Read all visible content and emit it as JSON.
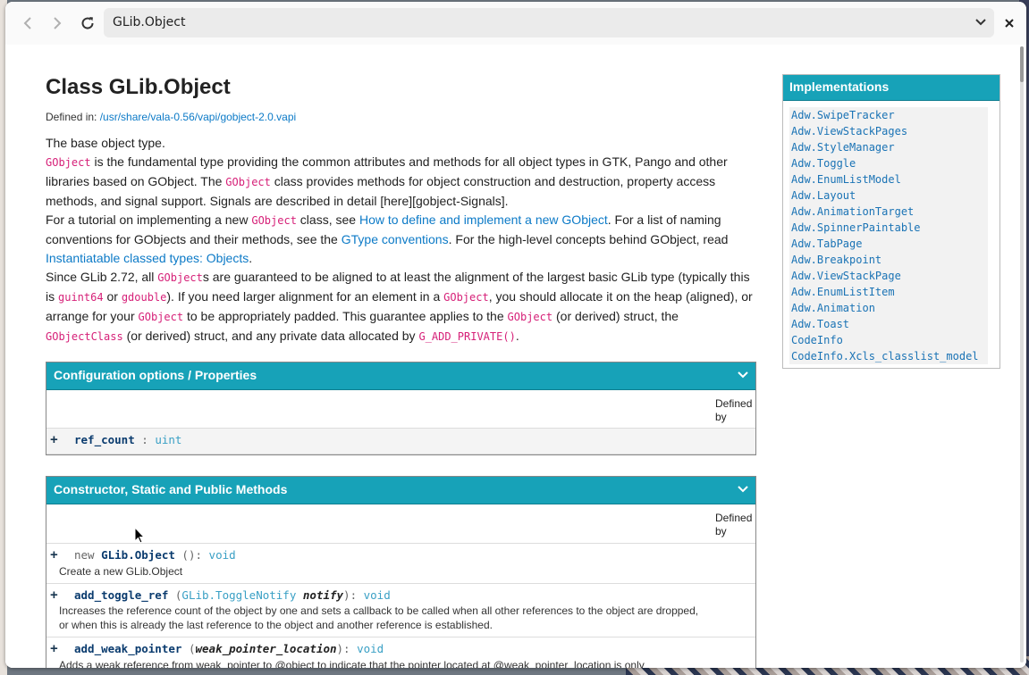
{
  "browser": {
    "page_title": "GLib.Object"
  },
  "page": {
    "heading": "Class GLib.Object",
    "defined_in_label": "Defined in: ",
    "defined_in_path": "/usr/share/vala-0.56/vapi/gobject-2.0.vapi",
    "desc": {
      "p1": "The base object type.",
      "p2_code1": "GObject",
      "p2_t1": " is the fundamental type providing the common attributes and methods for all object types in GTK, Pango and other libraries based on GObject. The ",
      "p2_code2": "GObject",
      "p2_t2": " class provides methods for object construction and destruction, property access methods, and signal support. Signals are described in detail [here][gobject-Signals].",
      "p3_t1": "For a tutorial on implementing a new ",
      "p3_code1": "GObject",
      "p3_t2": " class, see ",
      "p3_link1": "How to define and implement a new GObject",
      "p3_t3": ". For a list of naming conventions for GObjects and their methods, see the ",
      "p3_link2": "GType conventions",
      "p3_t4": ". For the high-level concepts behind GObject, read ",
      "p3_link3": "Instantiatable classed types: Objects",
      "p3_t5": ".",
      "p4_t1": "Since GLib 2.72, all ",
      "p4_code1": "GObject",
      "p4_t2": "s are guaranteed to be aligned to at least the alignment of the largest basic GLib type (typically this is ",
      "p4_code2": "guint64",
      "p4_t3": " or ",
      "p4_code3": "gdouble",
      "p4_t4": "). If you need larger alignment for an element in a ",
      "p4_code4": "GObject",
      "p4_t5": ", you should allocate it on the heap (aligned), or arrange for your ",
      "p4_code5": "GObject",
      "p4_t6": " to be appropriately padded. This guarantee applies to the ",
      "p4_code6": "GObject",
      "p4_t7": " (or derived) struct, the ",
      "p4_code7": "GObjectClass",
      "p4_t8": " (or derived) struct, and any private data allocated by ",
      "p4_code8": "G_ADD_PRIVATE()",
      "p4_t9": "."
    },
    "props_panel": {
      "title": "Configuration options / Properties",
      "defined_by": "Defined by",
      "rows": [
        {
          "plus": "+",
          "name": "ref_count",
          "sep": " : ",
          "type": "uint"
        }
      ]
    },
    "methods_panel": {
      "title": "Constructor, Static and Public Methods",
      "defined_by": "Defined by",
      "rows": [
        {
          "plus": "+",
          "prefix": "new ",
          "name": "GLib.Object",
          "args": " ()",
          "sep": ": ",
          "ret": "void",
          "desc": "Create a new GLib.Object"
        },
        {
          "plus": "+",
          "name": "add_toggle_ref",
          "open": " (",
          "arg_type": "GLib.ToggleNotify",
          "arg_name": "notify",
          "close": "): ",
          "ret": "void",
          "desc": "Increases the reference count of the object by one and sets a callback to be called when all other references to the object are dropped, or when this is already the last reference to the object and another reference is established."
        },
        {
          "plus": "+",
          "name": "add_weak_pointer",
          "open": " (",
          "arg_name": "weak_pointer_location",
          "close": "): ",
          "ret": "void",
          "desc": "Adds a weak reference from weak_pointer to @object to indicate that the pointer located at @weak_pointer_location is only"
        }
      ]
    },
    "implementations": {
      "title": "Implementations",
      "items": [
        "Adw.SwipeTracker",
        "Adw.ViewStackPages",
        "Adw.StyleManager",
        "Adw.Toggle",
        "Adw.EnumListModel",
        "Adw.Layout",
        "Adw.AnimationTarget",
        "Adw.SpinnerPaintable",
        "Adw.TabPage",
        "Adw.Breakpoint",
        "Adw.ViewStackPage",
        "Adw.EnumListItem",
        "Adw.Animation",
        "Adw.Toast",
        "CodeInfo",
        "CodeInfo.Xcls_classlist_model"
      ]
    }
  },
  "colors": {
    "accent": "#17a2b8",
    "link": "#0c7ac7",
    "code": "#d62078"
  }
}
